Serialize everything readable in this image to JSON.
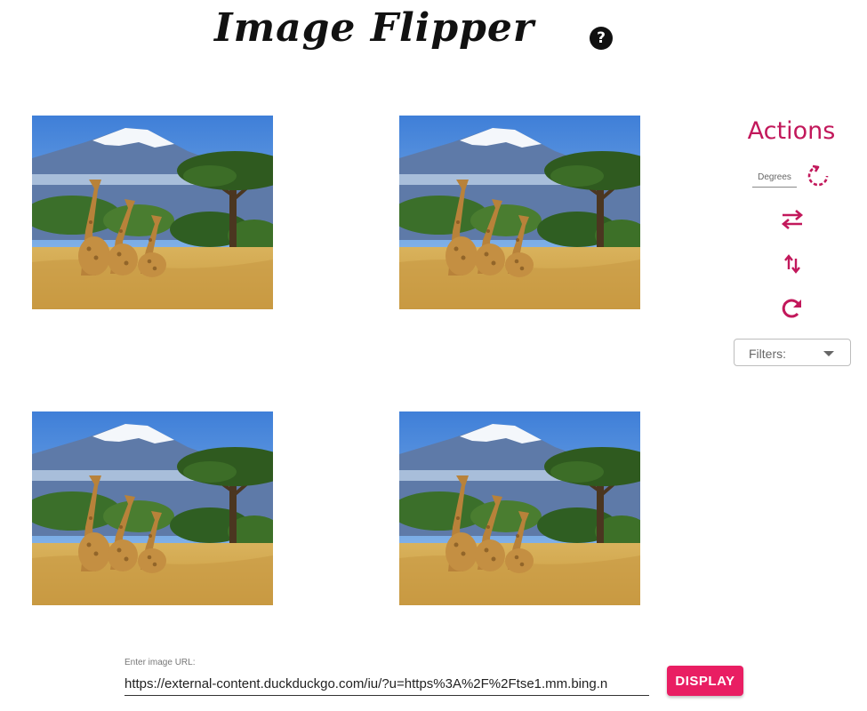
{
  "header": {
    "title": "Image Flipper",
    "help_icon": "question-circle-icon",
    "help_glyph": "?"
  },
  "images": [
    {
      "name": "giraffes-kilimanjaro-image"
    },
    {
      "name": "giraffes-kilimanjaro-image"
    },
    {
      "name": "giraffes-kilimanjaro-image"
    },
    {
      "name": "giraffes-kilimanjaro-image"
    }
  ],
  "actions": {
    "title": "Actions",
    "degrees_placeholder": "Degrees",
    "rotate_icon": "rotate-degrees-icon",
    "flip_horizontal_icon": "swap-horizontal-icon",
    "flip_vertical_icon": "swap-vertical-icon",
    "reset_icon": "redo-icon",
    "filters_label": "Filters:",
    "accent_color": "#c2185b"
  },
  "url_form": {
    "label": "Enter image URL:",
    "value": "https://external-content.duckduckgo.com/iu/?u=https%3A%2F%2Ftse1.mm.bing.n",
    "display_label": "DISPLAY",
    "button_color": "#e91e63"
  }
}
